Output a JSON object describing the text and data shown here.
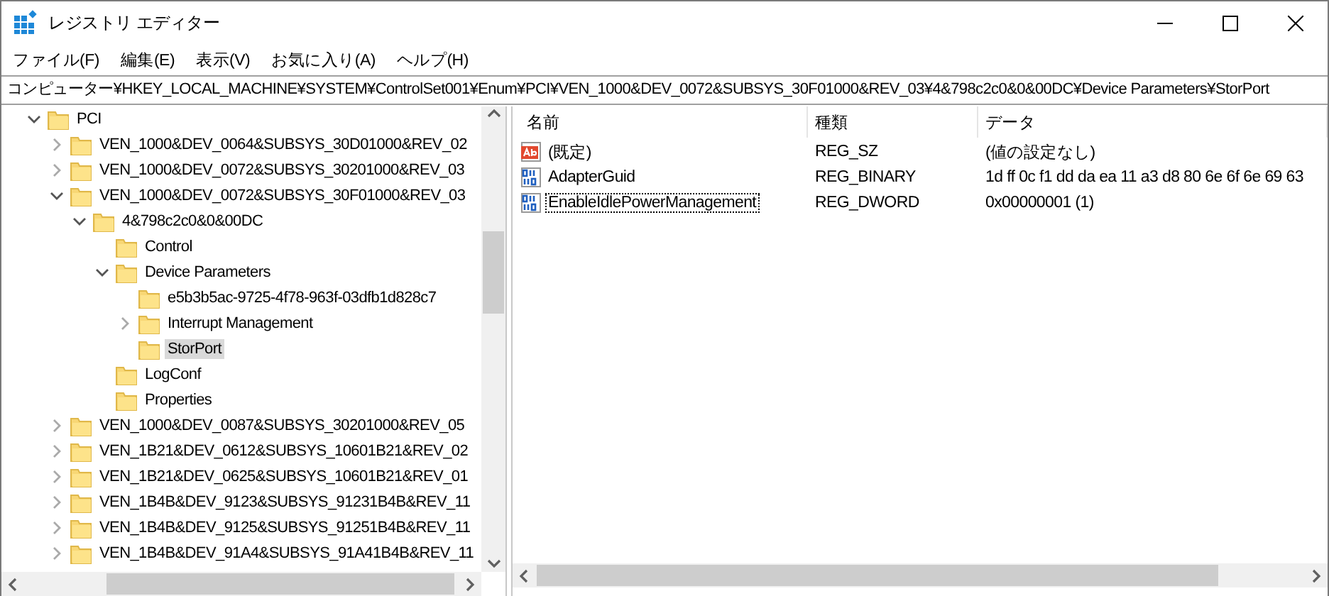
{
  "window": {
    "title": "レジストリ エディター"
  },
  "menu": [
    "ファイル(F)",
    "編集(E)",
    "表示(V)",
    "お気に入り(A)",
    "ヘルプ(H)"
  ],
  "address": "コンピューター¥HKEY_LOCAL_MACHINE¥SYSTEM¥ControlSet001¥Enum¥PCI¥VEN_1000&DEV_0072&SUBSYS_30F01000&REV_03¥4&798c2c0&0&00DC¥Device Parameters¥StorPort",
  "tree": [
    {
      "label": "PCI",
      "expanded": true,
      "selected": false,
      "children": [
        {
          "label": "VEN_1000&DEV_0064&SUBSYS_30D01000&REV_02",
          "expanded": false,
          "selected": false
        },
        {
          "label": "VEN_1000&DEV_0072&SUBSYS_30201000&REV_03",
          "expanded": false,
          "selected": false
        },
        {
          "label": "VEN_1000&DEV_0072&SUBSYS_30F01000&REV_03",
          "expanded": true,
          "selected": false,
          "children": [
            {
              "label": "4&798c2c0&0&00DC",
              "expanded": true,
              "selected": false,
              "children": [
                {
                  "label": "Control",
                  "selected": false
                },
                {
                  "label": "Device Parameters",
                  "expanded": true,
                  "selected": false,
                  "children": [
                    {
                      "label": "e5b3b5ac-9725-4f78-963f-03dfb1d828c7",
                      "selected": false
                    },
                    {
                      "label": "Interrupt Management",
                      "expanded": false,
                      "selected": false
                    },
                    {
                      "label": "StorPort",
                      "selected": true
                    }
                  ]
                },
                {
                  "label": "LogConf",
                  "selected": false
                },
                {
                  "label": "Properties",
                  "selected": false
                }
              ]
            }
          ]
        },
        {
          "label": "VEN_1000&DEV_0087&SUBSYS_30201000&REV_05",
          "expanded": false,
          "selected": false
        },
        {
          "label": "VEN_1B21&DEV_0612&SUBSYS_10601B21&REV_02",
          "expanded": false,
          "selected": false
        },
        {
          "label": "VEN_1B21&DEV_0625&SUBSYS_10601B21&REV_01",
          "expanded": false,
          "selected": false
        },
        {
          "label": "VEN_1B4B&DEV_9123&SUBSYS_91231B4B&REV_11",
          "expanded": false,
          "selected": false
        },
        {
          "label": "VEN_1B4B&DEV_9125&SUBSYS_91251B4B&REV_11",
          "expanded": false,
          "selected": false
        },
        {
          "label": "VEN_1B4B&DEV_91A4&SUBSYS_91A41B4B&REV_11",
          "expanded": false,
          "selected": false
        }
      ]
    }
  ],
  "values": {
    "columns": [
      "名前",
      "種類",
      "データ"
    ],
    "rows": [
      {
        "kind": "string",
        "name": "(既定)",
        "type": "REG_SZ",
        "data": "(値の設定なし)",
        "focused": false
      },
      {
        "kind": "binary",
        "name": "AdapterGuid",
        "type": "REG_BINARY",
        "data": "1d ff 0c f1 dd da ea 11 a3 d8 80 6e 6f 6e 69 63",
        "focused": false
      },
      {
        "kind": "binary",
        "name": "EnableIdlePowerManagement",
        "type": "REG_DWORD",
        "data": "0x00000001 (1)",
        "focused": true
      }
    ]
  }
}
